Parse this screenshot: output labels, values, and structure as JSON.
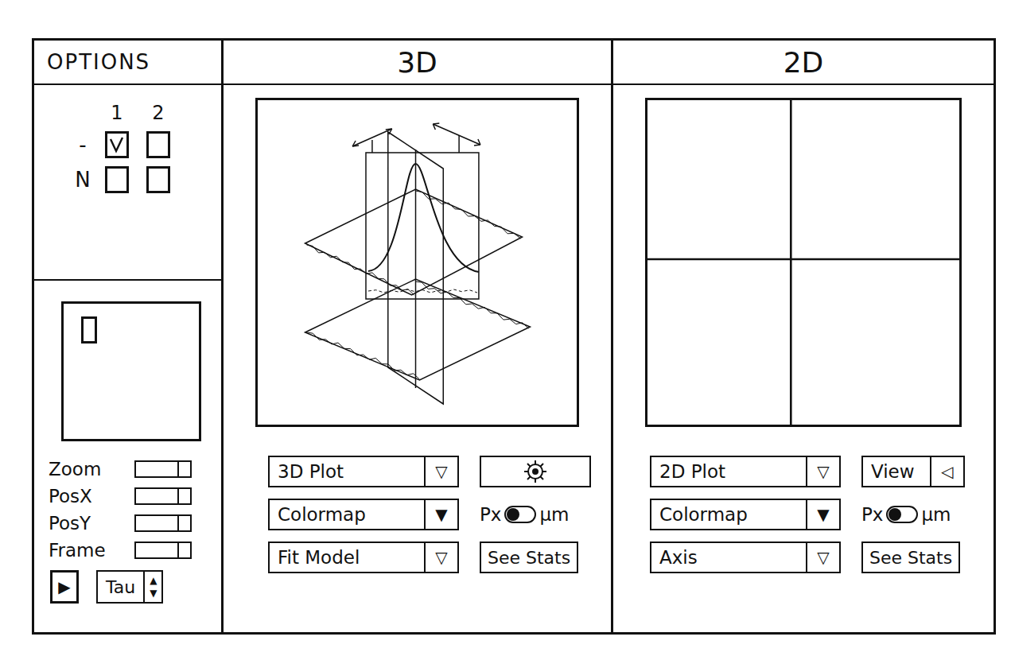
{
  "options": {
    "title": "OPTIONS",
    "grid": {
      "columns": [
        "1",
        "2"
      ],
      "rows": [
        {
          "label": "-",
          "cells": [
            {
              "checked": true
            },
            {
              "checked": false
            }
          ]
        },
        {
          "label": "N",
          "cells": [
            {
              "checked": false
            },
            {
              "checked": false
            }
          ]
        }
      ]
    },
    "fields": [
      {
        "label": "Zoom"
      },
      {
        "label": "PosX"
      },
      {
        "label": "PosY"
      },
      {
        "label": "Frame"
      }
    ],
    "play": "▶",
    "tau": {
      "label": "Tau",
      "up": "▲",
      "down": "▼"
    }
  },
  "panels": [
    {
      "title": "3D",
      "plot": {
        "kind": "surface3d"
      },
      "controls": [
        {
          "kind": "dropdown",
          "label": "3D Plot",
          "arrow": "▽"
        },
        {
          "kind": "gear"
        },
        {
          "kind": "dropdown",
          "label": "Colormap",
          "arrow": "▼"
        },
        {
          "kind": "toggle",
          "units": [
            {
              "label": "Px",
              "selected": true
            },
            {
              "label": "μm",
              "selected": false
            }
          ]
        },
        {
          "kind": "dropdown",
          "label": "Fit Model",
          "arrow": "▽"
        },
        {
          "kind": "button",
          "label": "See Stats"
        }
      ]
    },
    {
      "title": "2D",
      "plot": {
        "kind": "crosshair"
      },
      "controls": [
        {
          "kind": "dropdown",
          "label": "2D Plot",
          "arrow": "▽"
        },
        {
          "kind": "dropdown",
          "label": "View",
          "arrow": "◁"
        },
        {
          "kind": "dropdown",
          "label": "Colormap",
          "arrow": "▼"
        },
        {
          "kind": "toggle",
          "units": [
            {
              "label": "Px",
              "selected": true
            },
            {
              "label": "μm",
              "selected": false
            }
          ]
        },
        {
          "kind": "dropdown",
          "label": "Axis",
          "arrow": "▽"
        },
        {
          "kind": "button",
          "label": "See Stats"
        }
      ]
    }
  ]
}
